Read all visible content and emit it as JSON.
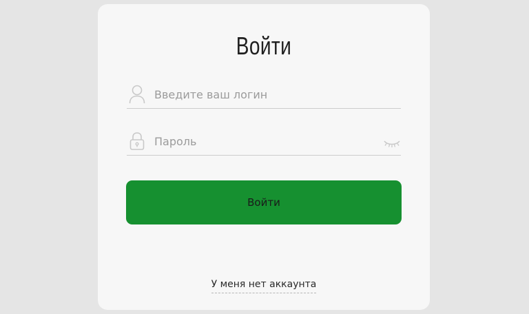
{
  "form": {
    "title": "Войти",
    "login": {
      "placeholder": "Введите ваш логин",
      "value": "",
      "icon": "user-icon"
    },
    "password": {
      "placeholder": "Пароль",
      "value": "",
      "icon": "lock-icon",
      "toggle_icon": "eye-closed-icon"
    },
    "submit_label": "Войти",
    "register_link": "У меня нет аккаунта"
  },
  "colors": {
    "page_background": "#e5e5e5",
    "card_background": "#f7f7f7",
    "button_background": "#169030",
    "icon_color": "#c8c8c8",
    "placeholder_color": "#9b9b9b"
  }
}
